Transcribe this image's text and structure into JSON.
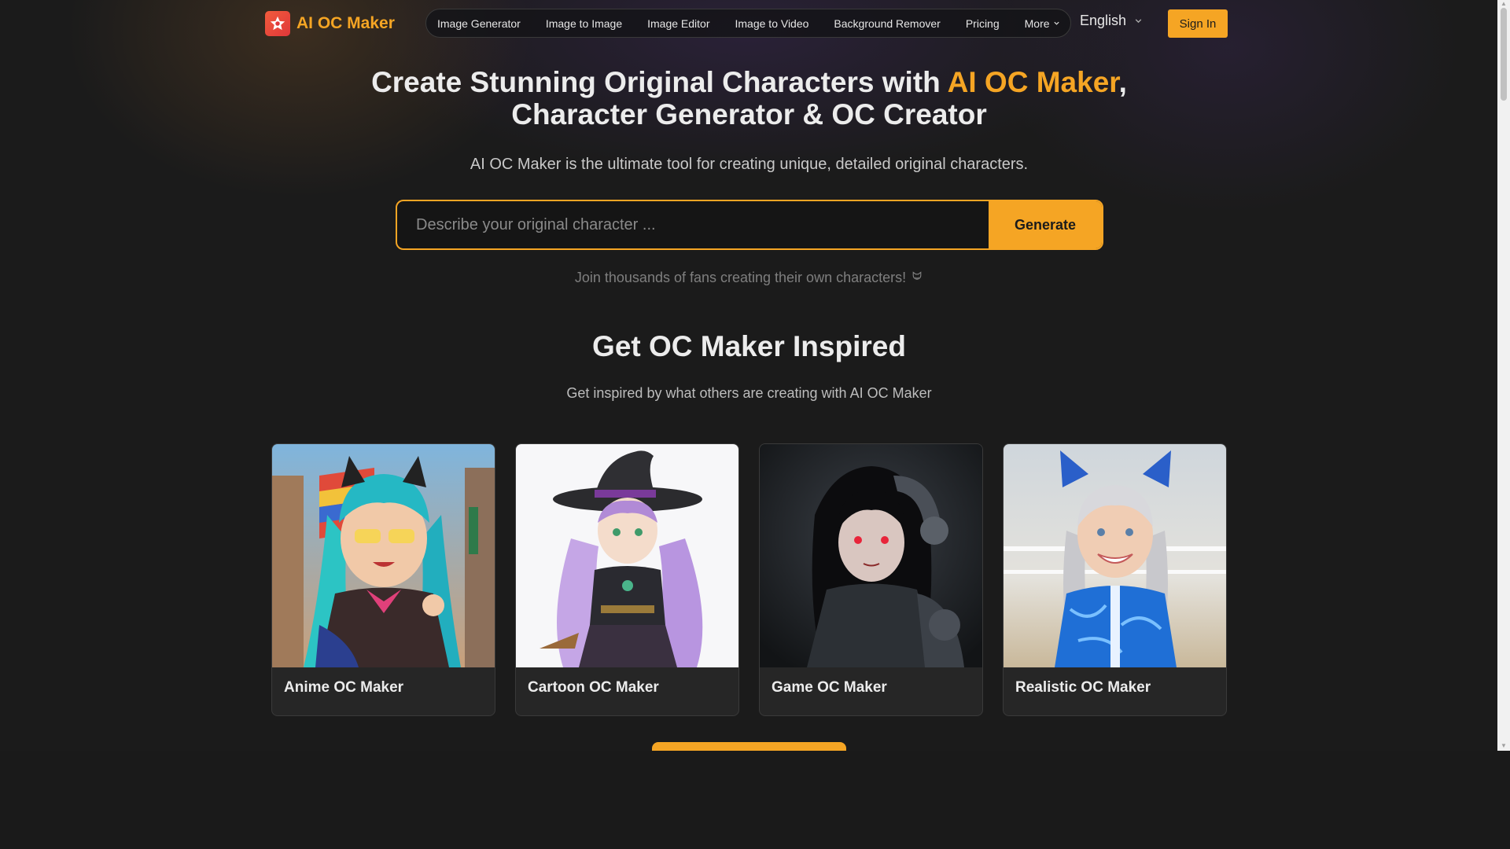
{
  "header": {
    "logo_text": "AI OC Maker",
    "nav": [
      "Image Generator",
      "Image to Image",
      "Image Editor",
      "Image to Video",
      "Background Remover",
      "Pricing"
    ],
    "more_label": "More",
    "language": "English",
    "signin_label": "Sign In"
  },
  "hero": {
    "title_part1": "Create Stunning Original Characters with ",
    "title_accent": "AI OC Maker",
    "title_part2": ", Character Generator & OC Creator",
    "subtitle": "AI OC Maker is the ultimate tool for creating unique, detailed original characters.",
    "input_placeholder": "Describe your original character ...",
    "generate_label": "Generate",
    "join_text": "Join thousands of fans creating their own characters!"
  },
  "inspired": {
    "title": "Get OC Maker Inspired",
    "subtitle": "Get inspired by what others are creating with AI OC Maker",
    "cards": [
      {
        "label": "Anime OC Maker"
      },
      {
        "label": "Cartoon OC Maker"
      },
      {
        "label": "Game OC Maker"
      },
      {
        "label": "Realistic OC Maker"
      }
    ]
  },
  "colors": {
    "accent": "#f5a524",
    "background": "#1b1b1b",
    "card": "#262626"
  }
}
